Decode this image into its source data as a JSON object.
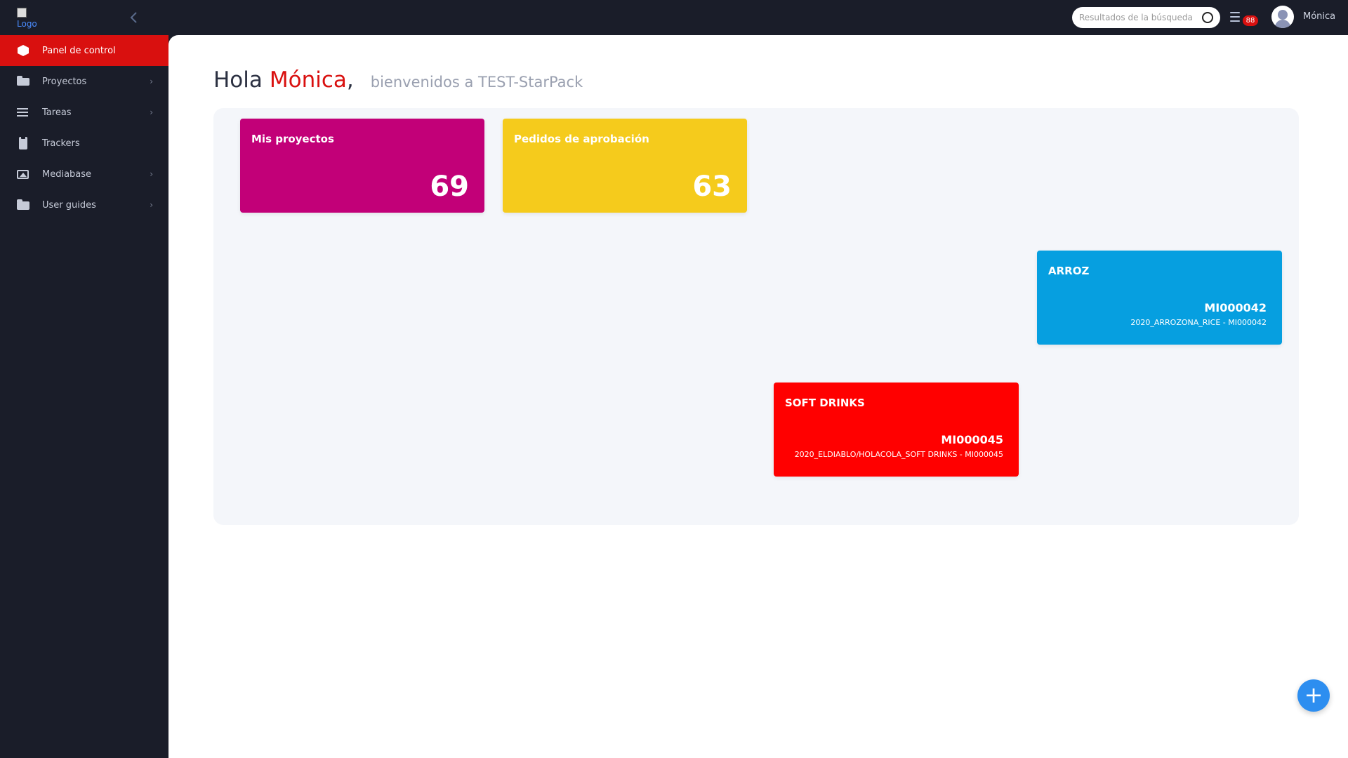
{
  "header": {
    "logo_alt": "Logo",
    "search": {
      "placeholder": "Resultados de la búsqueda"
    },
    "notification_count": "88",
    "user_name": "Mónica"
  },
  "sidebar": {
    "items": [
      {
        "label": "Panel de control",
        "icon": "cube-icon",
        "active": true,
        "has_submenu": false
      },
      {
        "label": "Proyectos",
        "icon": "folder-open-icon",
        "active": false,
        "has_submenu": true
      },
      {
        "label": "Tareas",
        "icon": "list-icon",
        "active": false,
        "has_submenu": true
      },
      {
        "label": "Trackers",
        "icon": "clipboard-icon",
        "active": false,
        "has_submenu": false
      },
      {
        "label": "Mediabase",
        "icon": "image-icon",
        "active": false,
        "has_submenu": true
      },
      {
        "label": "User guides",
        "icon": "folder-icon",
        "active": false,
        "has_submenu": true
      }
    ]
  },
  "main": {
    "greeting": {
      "hello": "Hola",
      "name": "Mónica",
      "comma": ",",
      "welcome": "bienvenidos a TEST-StarPack"
    },
    "cards": {
      "projects": {
        "title": "Mis proyectos",
        "count": "69",
        "color": "#c20078"
      },
      "approval": {
        "title": "Pedidos de aprobación",
        "count": "63",
        "color": "#f5cb1c"
      },
      "arroz": {
        "title": "ARROZ",
        "code": "MI000042",
        "sub": "2020_ARROZONA_RICE - MI000042",
        "color": "#069fe0"
      },
      "soft_drinks": {
        "title": "SOFT DRINKS",
        "code": "MI000045",
        "sub": "2020_ELDIABLO/HOLACOLA_SOFT DRINKS - MI000045",
        "color": "#ff0000"
      }
    },
    "fab_label": "+"
  },
  "colors": {
    "accent": "#d9100f",
    "sidebar_bg": "#1a1d29",
    "fab": "#2d8ef0"
  }
}
